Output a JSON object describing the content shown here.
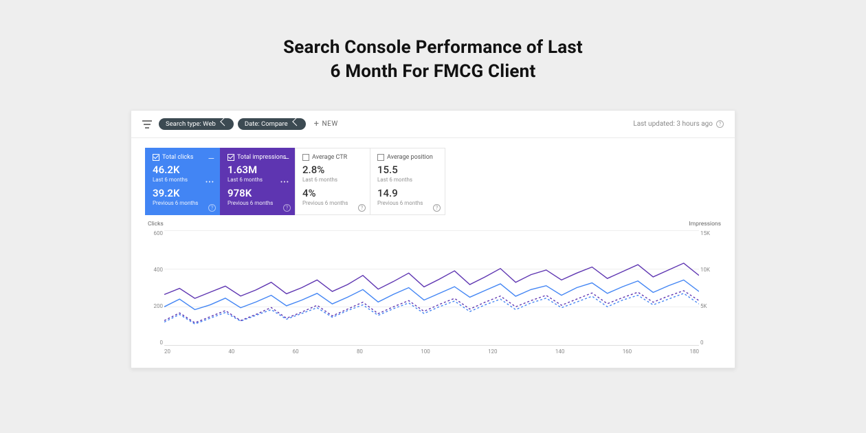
{
  "title_line1": "Search Console Performance of Last",
  "title_line2": "6 Month For FMCG Client",
  "filter_bar": {
    "chip_search_type": "Search type: Web",
    "chip_date": "Date: Compare",
    "new_label": "NEW",
    "updated_label": "Last updated: 3 hours ago"
  },
  "tiles": {
    "clicks": {
      "title": "Total clicks",
      "value": "46.2K",
      "sub1": "Last 6 months",
      "value2": "39.2K",
      "sub2": "Previous 6 months"
    },
    "impressions": {
      "title": "Total impressions",
      "value": "1.63M",
      "sub1": "Last 6 months",
      "value2": "978K",
      "sub2": "Previous 6 months"
    },
    "ctr": {
      "title": "Average CTR",
      "value": "2.8%",
      "sub1": "Last 6 months",
      "value2": "4%",
      "sub2": "Previous 6 months"
    },
    "position": {
      "title": "Average position",
      "value": "15.5",
      "sub1": "Last 6 months",
      "value2": "14.9",
      "sub2": "Previous 6 months"
    }
  },
  "axes": {
    "left_title": "Clicks",
    "right_title": "Impressions",
    "y_left": [
      "600",
      "400",
      "200",
      "0"
    ],
    "y_right": [
      "15K",
      "10K",
      "5K",
      "0"
    ],
    "x_ticks": [
      "20",
      "40",
      "60",
      "80",
      "100",
      "120",
      "140",
      "160",
      "180"
    ]
  },
  "chart_data": {
    "type": "line",
    "x_range": [
      0,
      183
    ],
    "xlabel": "",
    "y_left": {
      "label": "Clicks",
      "range": [
        0,
        600
      ]
    },
    "y_right": {
      "label": "Impressions",
      "range": [
        0,
        15000
      ]
    },
    "series": [
      {
        "name": "Total clicks – Last 6 months",
        "axis": "left",
        "style": "solid",
        "color": "#4285f4",
        "values": [
          200,
          240,
          185,
          210,
          245,
          195,
          225,
          260,
          205,
          235,
          270,
          215,
          250,
          290,
          225,
          265,
          300,
          235,
          270,
          305,
          250,
          285,
          320,
          255,
          290,
          310,
          260,
          300,
          325,
          270,
          305,
          335,
          275,
          310,
          340,
          280
        ]
      },
      {
        "name": "Total clicks – Previous 6 months",
        "axis": "left",
        "style": "dashed",
        "color": "#4285f4",
        "values": [
          120,
          160,
          110,
          140,
          170,
          125,
          155,
          185,
          135,
          165,
          195,
          145,
          180,
          210,
          155,
          190,
          220,
          165,
          200,
          230,
          175,
          210,
          240,
          185,
          220,
          245,
          195,
          225,
          255,
          200,
          235,
          260,
          210,
          240,
          270,
          215
        ]
      },
      {
        "name": "Total impressions – Last 6 months",
        "axis": "right",
        "style": "solid",
        "color": "#5e35b1",
        "values": [
          6600,
          7400,
          6100,
          6900,
          7700,
          6400,
          7200,
          8200,
          6700,
          7500,
          8500,
          7000,
          7900,
          9100,
          7300,
          8300,
          9400,
          7600,
          8600,
          9700,
          7900,
          8900,
          10000,
          8200,
          9200,
          9800,
          8500,
          9400,
          10200,
          8700,
          9600,
          10500,
          8900,
          9800,
          10700,
          9100
        ]
      },
      {
        "name": "Total impressions – Previous 6 months",
        "axis": "right",
        "style": "dashed",
        "color": "#5e35b1",
        "values": [
          3200,
          4200,
          2900,
          3700,
          4500,
          3200,
          4000,
          4900,
          3500,
          4300,
          5200,
          3800,
          4700,
          5600,
          4100,
          5000,
          5800,
          4400,
          5300,
          6100,
          4700,
          5600,
          6400,
          5000,
          5800,
          6500,
          5200,
          6000,
          6800,
          5400,
          6200,
          6900,
          5600,
          6400,
          7100,
          5800
        ]
      }
    ],
    "note": "Daily values over ~183 days; arrays above are 36 evenly-spaced samples (~every 5 days) estimated from gridlines."
  }
}
